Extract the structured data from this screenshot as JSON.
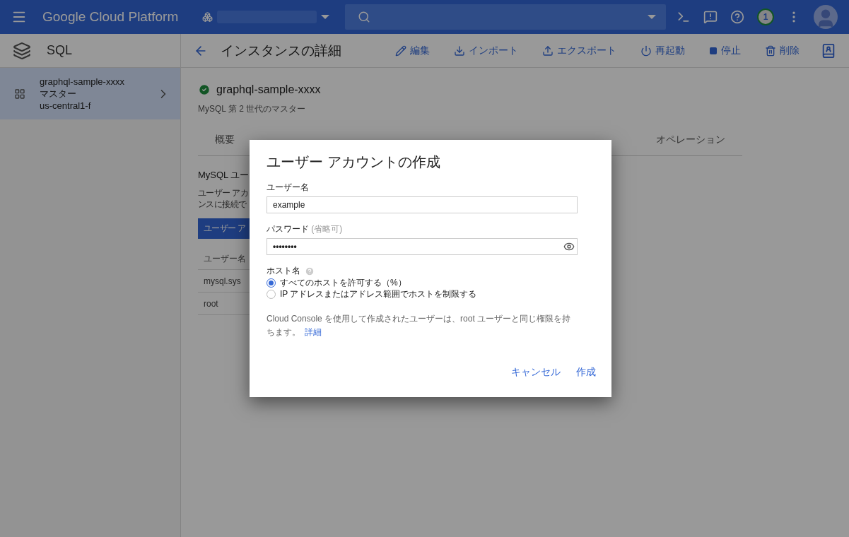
{
  "header": {
    "title": "Google Cloud Platform",
    "notifications": "1"
  },
  "sidebar": {
    "product": "SQL",
    "items": [
      {
        "name": "graphql-sample-xxxx",
        "role": "マスター",
        "zone": "us-central1-f",
        "selected": true
      }
    ]
  },
  "toolbar": {
    "title": "インスタンスの詳細",
    "actions": [
      {
        "label": "編集",
        "kind": "edit"
      },
      {
        "label": "インポート",
        "kind": "import"
      },
      {
        "label": "エクスポート",
        "kind": "export"
      },
      {
        "label": "再起動",
        "kind": "restart"
      },
      {
        "label": "停止",
        "kind": "stop"
      },
      {
        "label": "削除",
        "kind": "delete"
      }
    ]
  },
  "instance": {
    "name": "graphql-sample-xxxx",
    "healthy": true,
    "description": "MySQL 第 2 世代のマスター"
  },
  "tabs": [
    {
      "label": "概要",
      "selected": false
    },
    {
      "label": "オペレーション",
      "selected": false
    }
  ],
  "users_section": {
    "heading": "MySQL ユー",
    "description_lines": [
      "ユーザー アカ",
      "ンスに接続で"
    ],
    "add_button": "ユーザー ア",
    "table": {
      "columns": [
        "ユーザー名"
      ],
      "rows": [
        [
          "mysql.sys"
        ],
        [
          "root"
        ]
      ]
    }
  },
  "dialog": {
    "title": "ユーザー アカウントの作成",
    "username": {
      "label": "ユーザー名",
      "value": "example"
    },
    "password": {
      "label": "パスワード",
      "hint": "(省略可)",
      "value": "••••••••"
    },
    "host": {
      "label": "ホスト名",
      "options": [
        {
          "label": "すべてのホストを許可する（%）",
          "selected": true
        },
        {
          "label": "IP アドレスまたはアドレス範囲でホストを制限する",
          "selected": false
        }
      ]
    },
    "note": "Cloud Console を使用して作成されたユーザーは、root ユーザーと同じ権限を持ちます。",
    "link": "詳細",
    "buttons": [
      "キャンセル",
      "作成"
    ]
  }
}
